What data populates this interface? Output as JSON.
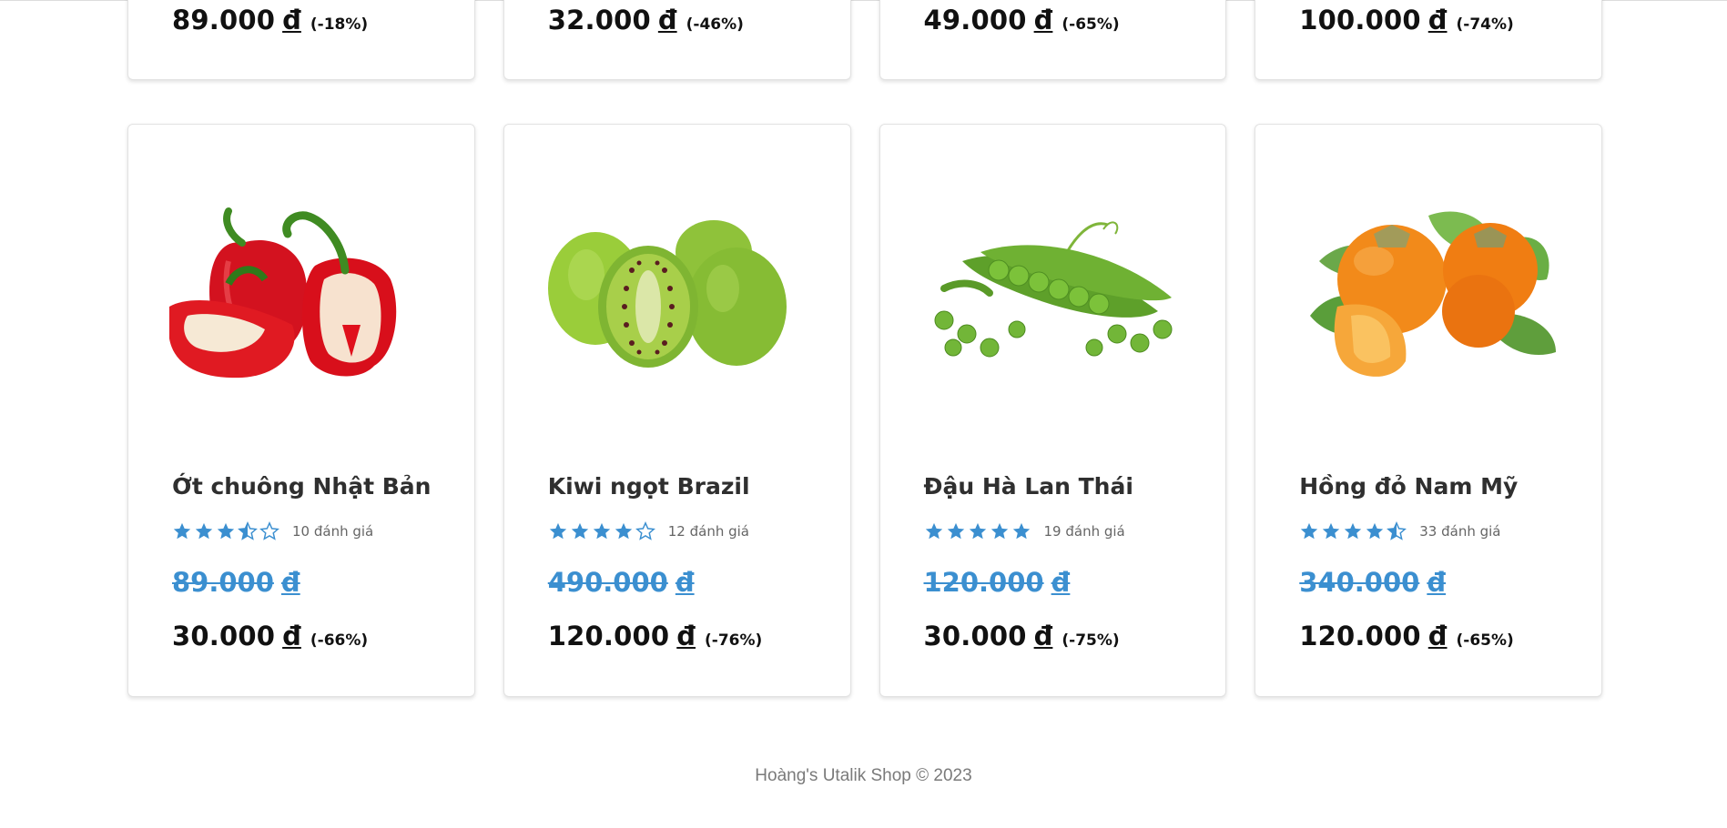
{
  "currency_symbol": "đ",
  "top_row": [
    {
      "price": "89.000",
      "discount": "(-18%)"
    },
    {
      "price": "32.000",
      "discount": "(-46%)"
    },
    {
      "price": "49.000",
      "discount": "(-65%)"
    },
    {
      "price": "100.000",
      "discount": "(-74%)"
    }
  ],
  "products": [
    {
      "name": "Ớt chuông Nhật Bản",
      "rating": 3.5,
      "reviews": "10 đánh giá",
      "old_price": "89.000",
      "price": "30.000",
      "discount": "(-66%)",
      "image": "red-bell-pepper"
    },
    {
      "name": "Kiwi ngọt Brazil",
      "rating": 4,
      "reviews": "12 đánh giá",
      "old_price": "490.000",
      "price": "120.000",
      "discount": "(-76%)",
      "image": "kiwi-berries"
    },
    {
      "name": "Đậu Hà Lan Thái",
      "rating": 5,
      "reviews": "19 đánh giá",
      "old_price": "120.000",
      "price": "30.000",
      "discount": "(-75%)",
      "image": "green-peas"
    },
    {
      "name": "Hồng đỏ Nam Mỹ",
      "rating": 4.5,
      "reviews": "33 đánh giá",
      "old_price": "340.000",
      "price": "120.000",
      "discount": "(-65%)",
      "image": "persimmons"
    }
  ],
  "footer": {
    "text": "Hoàng's Utalik Shop © 2023"
  },
  "colors": {
    "star": "#3b8fd0",
    "old_price": "#3b8fd0"
  }
}
